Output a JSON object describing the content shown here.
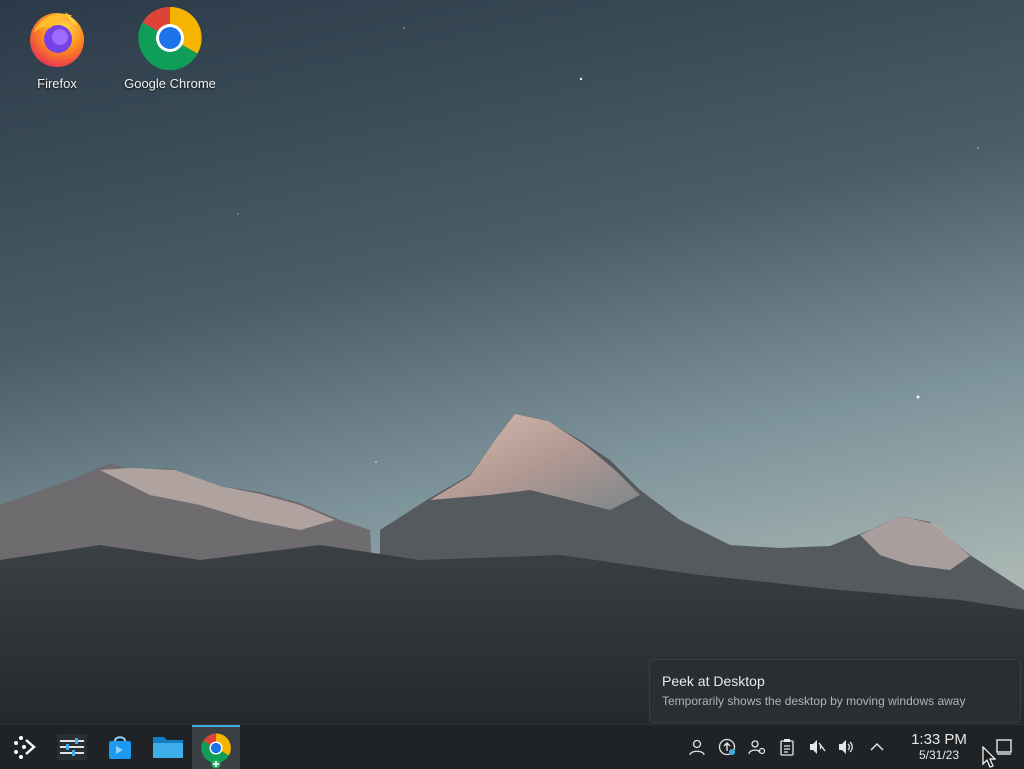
{
  "desktop": {
    "icons": [
      {
        "label": "Firefox",
        "icon": "firefox-icon"
      },
      {
        "label": "Google Chrome",
        "icon": "chrome-icon"
      }
    ]
  },
  "taskbar": {
    "launcher_icon": "app-launcher-icon",
    "pinned": [
      {
        "icon": "system-settings-icon"
      },
      {
        "icon": "discover-store-icon"
      },
      {
        "icon": "file-manager-icon"
      },
      {
        "icon": "chrome-icon",
        "active": true
      }
    ],
    "tray_icons": [
      "user-icon",
      "update-icon",
      "accounts-icon",
      "clipboard-icon",
      "speaker-muted-icon",
      "volume-icon",
      "chevron-up-icon"
    ],
    "clock": {
      "time": "1:33 PM",
      "date": "5/31/23"
    },
    "peek_icon": "show-desktop-icon"
  },
  "tooltip": {
    "title": "Peek at Desktop",
    "subtitle": "Temporarily shows the desktop by moving windows away"
  },
  "colors": {
    "accent": "#3daee9",
    "taskbar": "#202326"
  }
}
